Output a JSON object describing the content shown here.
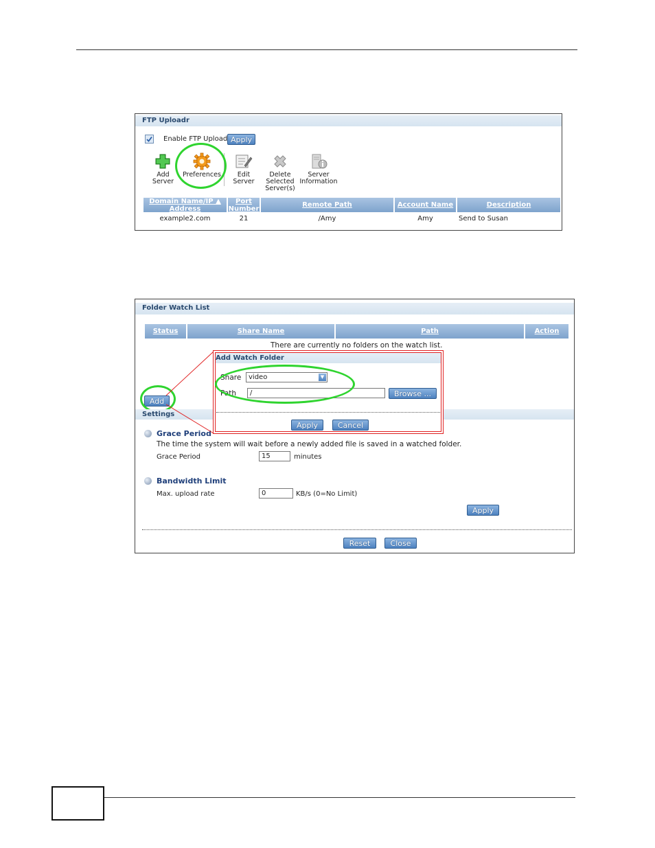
{
  "ftp_panel": {
    "title": "FTP Uploadr",
    "enable_label": "Enable FTP Uploadr",
    "enable_checked": true,
    "apply_label": "Apply",
    "toolbar": [
      {
        "label_line1": "Add",
        "label_line2": "Server",
        "label_line3": "",
        "icon": "add-icon"
      },
      {
        "label_line1": "Preferences",
        "label_line2": "",
        "label_line3": "",
        "icon": "gear-icon"
      },
      {
        "label_line1": "Edit",
        "label_line2": "Server",
        "label_line3": "",
        "icon": "edit-icon"
      },
      {
        "label_line1": "Delete",
        "label_line2": "Selected",
        "label_line3": "Server(s)",
        "icon": "delete-icon"
      },
      {
        "label_line1": "Server",
        "label_line2": "Information",
        "label_line3": "",
        "icon": "info-icon"
      }
    ],
    "columns": {
      "domain_line1": "Domain Name/IP",
      "domain_line2": "Address",
      "port_line1": "Port",
      "port_line2": "Number",
      "remote_path": "Remote Path",
      "account_name": "Account Name",
      "description": "Description"
    },
    "rows": [
      {
        "domain": "example2.com",
        "port": "21",
        "remote_path": "/Amy",
        "account": "Amy",
        "description": "Send to Susan"
      }
    ]
  },
  "folder_panel": {
    "title": "Folder Watch List",
    "columns": {
      "status": "Status",
      "share_name": "Share Name",
      "path": "Path",
      "action": "Action"
    },
    "empty_message": "There are currently no folders on the watch list.",
    "add_label": "Add",
    "settings_title": "Settings",
    "grace": {
      "title": "Grace Period",
      "description": "The time the system will wait before a newly added file is saved in a watched folder.",
      "label": "Grace Period",
      "value": "15",
      "unit": "minutes"
    },
    "bandwidth": {
      "title": "Bandwidth Limit",
      "label": "Max. upload rate",
      "value": "0",
      "unit": "KB/s (0=No Limit)"
    },
    "apply_label": "Apply",
    "reset_label": "Reset",
    "close_label": "Close"
  },
  "popup": {
    "title": "Add Watch Folder",
    "share_label": "Share",
    "share_value": "video",
    "path_label": "Path",
    "path_value": "/",
    "browse_label": "Browse ...",
    "apply_label": "Apply",
    "cancel_label": "Cancel"
  },
  "colors": {
    "header_blue": "#7ea3cd",
    "highlight_green": "#2fd42f",
    "callout_red": "#e02020"
  }
}
